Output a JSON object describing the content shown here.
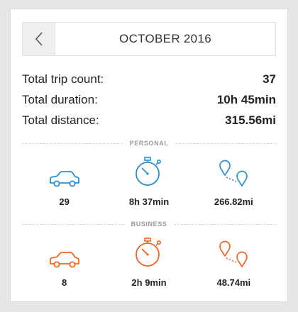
{
  "header": {
    "month": "OCTOBER 2016",
    "back_icon": "chevron-left-icon"
  },
  "totals": {
    "trip_count_label": "Total trip count:",
    "trip_count_value": "37",
    "duration_label": "Total duration:",
    "duration_value": "10h 45min",
    "distance_label": "Total distance:",
    "distance_value": "315.56mi"
  },
  "personal": {
    "label": "PERSONAL",
    "color": "#2a8fd6",
    "trips": "29",
    "duration": "8h 37min",
    "distance": "266.82mi"
  },
  "business": {
    "label": "BUSINESS",
    "color": "#f26522",
    "trips": "8",
    "duration": "2h 9min",
    "distance": "48.74mi"
  },
  "icons": {
    "trips": "car-icon",
    "duration": "stopwatch-icon",
    "distance": "route-pins-icon"
  }
}
